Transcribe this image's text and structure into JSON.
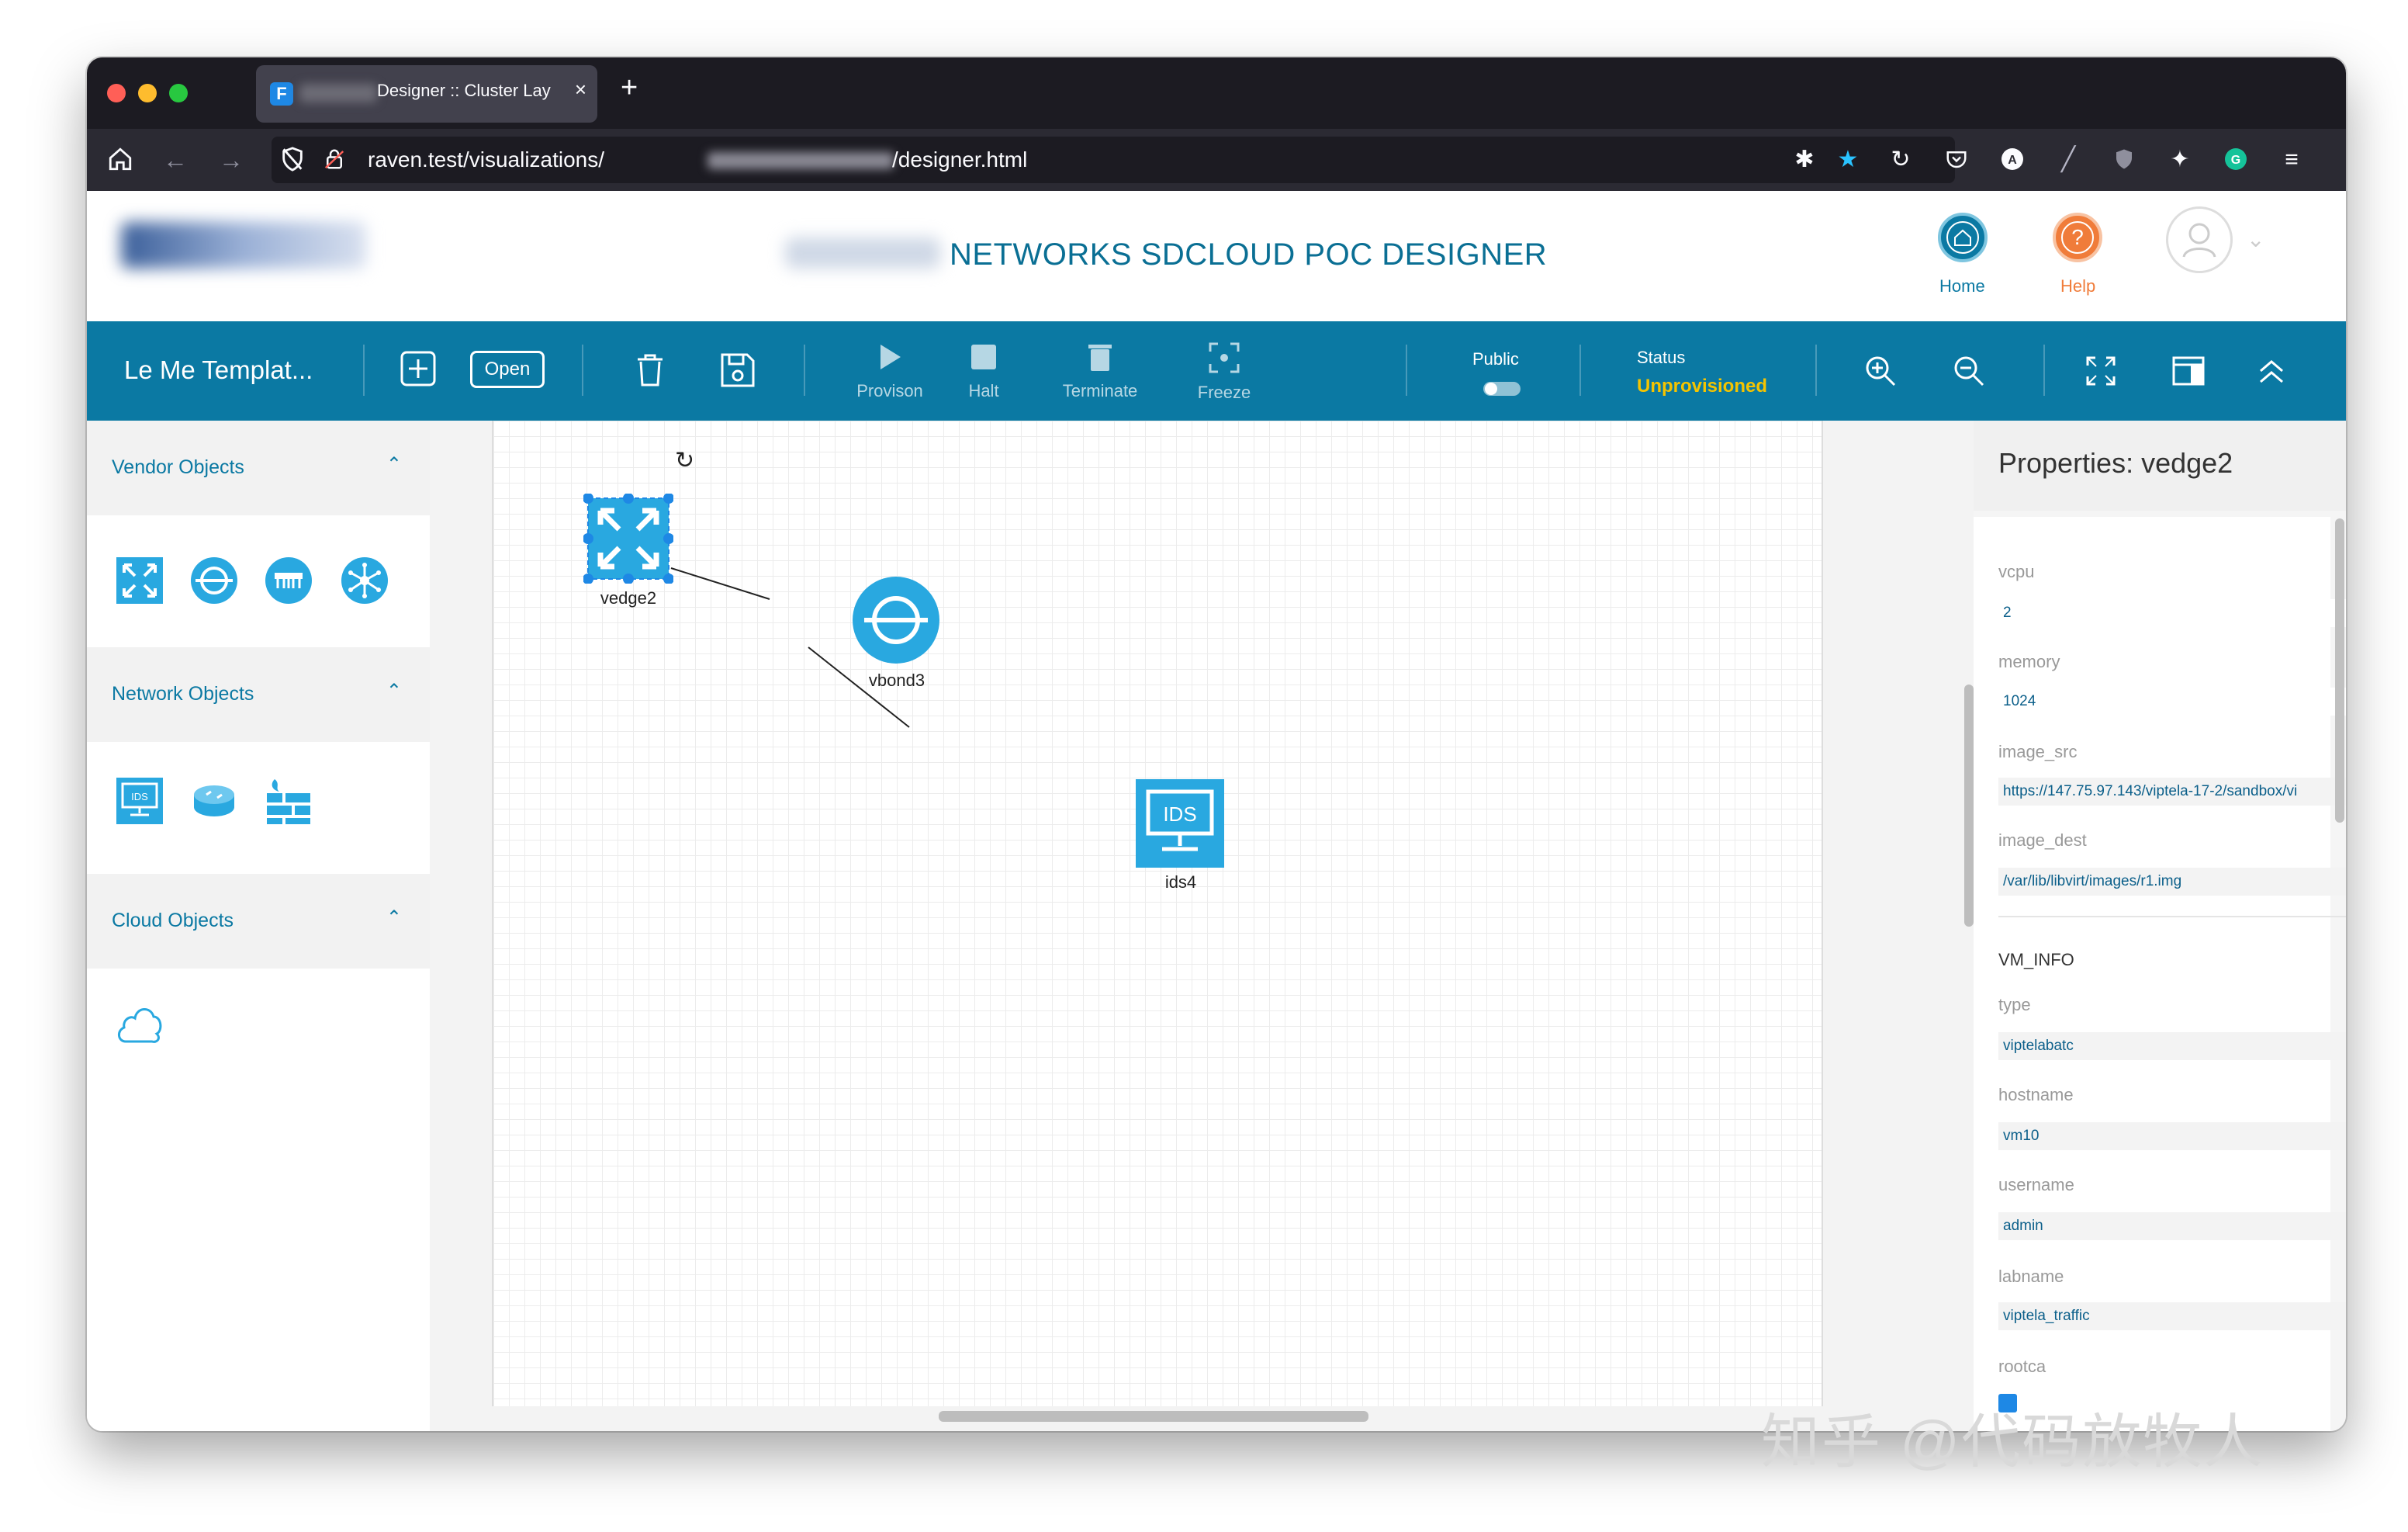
{
  "browser": {
    "tab_title": "Designer :: Cluster Lay",
    "url_prefix": "raven.test/visualizations/",
    "url_suffix": "/designer.html"
  },
  "header": {
    "title": "NETWORKS SDCLOUD POC DESIGNER",
    "home_label": "Home",
    "help_label": "Help",
    "help_glyph": "?"
  },
  "toolbar": {
    "template_name": "Le Me Templat...",
    "open_label": "Open",
    "provision_label": "Provison",
    "halt_label": "Halt",
    "terminate_label": "Terminate",
    "freeze_label": "Freeze",
    "public_label": "Public",
    "public_enabled": false,
    "status_label": "Status",
    "status_value": "Unprovisioned",
    "status_color": "#f5c400"
  },
  "sidebar": {
    "sections": [
      {
        "title": "Vendor Objects"
      },
      {
        "title": "Network Objects"
      },
      {
        "title": "Cloud Objects"
      }
    ],
    "ids_badge": "IDS"
  },
  "canvas": {
    "nodes": [
      {
        "label": "vedge2",
        "icon": "vedge-router-icon",
        "selected": true
      },
      {
        "label": "vbond3",
        "icon": "vbond-icon"
      },
      {
        "label": "ids4",
        "icon": "ids-monitor-icon",
        "badge": "IDS"
      }
    ]
  },
  "properties": {
    "title": "Properties: vedge2",
    "vcpu_label": "vcpu",
    "vcpu_value": "2",
    "memory_label": "memory",
    "memory_value": "1024",
    "image_src_label": "image_src",
    "image_src_value": "https://147.75.97.143/viptela-17-2/sandbox/vi",
    "image_dest_label": "image_dest",
    "image_dest_value": "/var/lib/libvirt/images/r1.img",
    "vm_info_label": "VM_INFO",
    "type_label": "type",
    "type_value": "viptelabatc",
    "hostname_label": "hostname",
    "hostname_value": "vm10",
    "username_label": "username",
    "username_value": "admin",
    "labname_label": "labname",
    "labname_value": "viptela_traffic",
    "rootca_label": "rootca"
  },
  "watermark": "知乎 @代码放牧人",
  "colors": {
    "brand_blue": "#0b79a3",
    "icon_blue": "#29a8e0",
    "home_circle": "#0b79a3",
    "help_circle": "#f07c3a"
  }
}
